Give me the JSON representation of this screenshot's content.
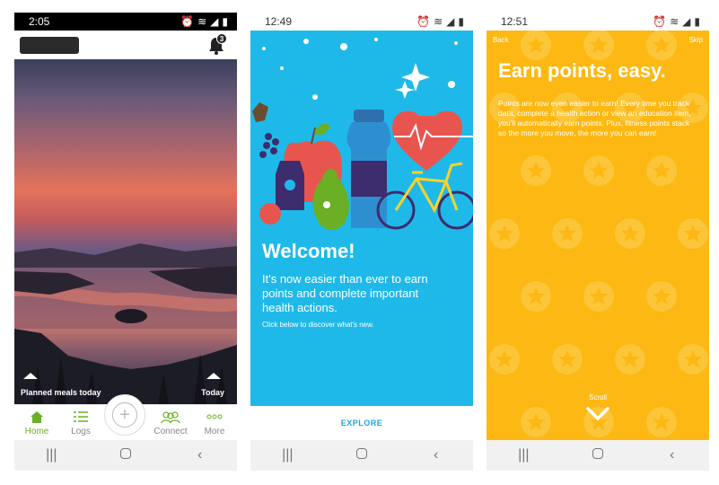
{
  "screens": [
    {
      "status_time": "2:05",
      "bell_badge": "3",
      "labels": {
        "left": "Planned meals today",
        "right": "Today"
      },
      "tabs": [
        {
          "label": "Home",
          "icon": "house-icon",
          "active": true
        },
        {
          "label": "Logs",
          "icon": "list-icon",
          "active": false
        },
        {
          "label": "Connect",
          "icon": "people-icon",
          "active": false
        },
        {
          "label": "More",
          "icon": "dots-icon",
          "active": false
        }
      ]
    },
    {
      "status_time": "12:49",
      "title": "Welcome!",
      "subtitle": "It's now easier than ever to earn points and complete important health actions.",
      "small_text": "Click below to discover what's new.",
      "explore_label": "EXPLORE"
    },
    {
      "status_time": "12:51",
      "back_label": "Back",
      "skip_label": "Skip",
      "title": "Earn points, easy.",
      "body": "Points are now even easier to earn! Every time you track data, complete a health action or view an education item, you'll automatically earn points. Plus, fitness points stack so the more you move, the more you can earn!",
      "scroll_label": "Scroll"
    }
  ],
  "colors": {
    "welcome_bg": "#1fb9e9",
    "points_bg": "#fdb813",
    "accent_green": "#6aaf24",
    "explore_blue": "#1fa5d9"
  }
}
